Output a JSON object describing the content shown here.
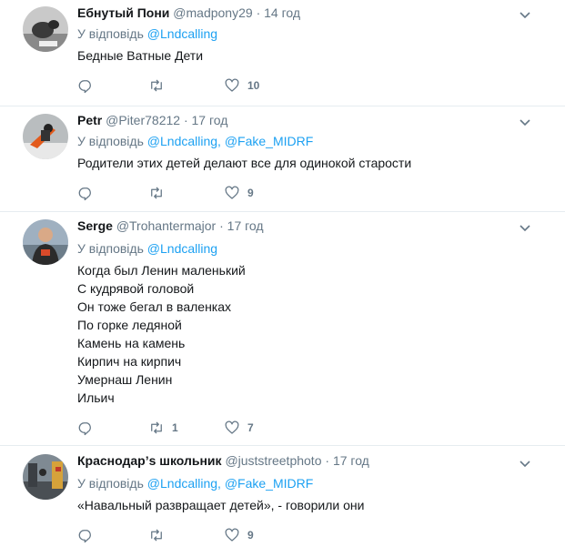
{
  "tweets": [
    {
      "name": "Ебнутый Пони",
      "handle": "@madpony29",
      "sep": "·",
      "time": "14 год",
      "reply_prefix": "У відповідь",
      "mentions": [
        "@Lndcalling"
      ],
      "text_lines": [
        "Бедные Ватные Дети"
      ],
      "reply_count": "",
      "retweet_count": "",
      "like_count": "10",
      "avatar_icon": "avatar-photo-pony"
    },
    {
      "name": "Petr",
      "handle": "@Piter78212",
      "sep": "·",
      "time": "17 год",
      "reply_prefix": "У відповідь",
      "mentions": [
        "@Lndcalling,",
        "@Fake_MIDRF"
      ],
      "text_lines": [
        "Родители этих детей делают все для одинокой старости"
      ],
      "reply_count": "",
      "retweet_count": "",
      "like_count": "9",
      "avatar_icon": "avatar-photo-snowboard"
    },
    {
      "name": "Serge",
      "handle": "@Trohantermajor",
      "sep": "·",
      "time": "17 год",
      "reply_prefix": "У відповідь",
      "mentions": [
        "@Lndcalling"
      ],
      "text_lines": [
        "Когда был Ленин маленький",
        "С кудрявой головой",
        "Он тоже бегал в валенках",
        "По горке ледяной",
        "Камень на камень",
        "Кирпич на кирпич",
        "Умернаш Ленин",
        "Ильич"
      ],
      "reply_count": "",
      "retweet_count": "1",
      "like_count": "7",
      "avatar_icon": "avatar-photo-man"
    },
    {
      "name": "Краснодар’s школьник",
      "handle": "@juststreetphoto",
      "sep": "·",
      "time": "17 год",
      "reply_prefix": "У відповідь",
      "mentions": [
        "@Lndcalling,",
        "@Fake_MIDRF"
      ],
      "text_lines": [
        "«Навальный развращает детей», - говорили они"
      ],
      "reply_count": "",
      "retweet_count": "",
      "like_count": "9",
      "avatar_icon": "avatar-photo-street"
    }
  ],
  "colors": {
    "accent": "#1da1f2",
    "muted": "#657786",
    "text": "#14171a",
    "divider": "#e6ecf0"
  },
  "icons": {
    "reply": "reply-icon",
    "retweet": "retweet-icon",
    "like": "heart-icon",
    "menu": "chevron-down-icon"
  }
}
